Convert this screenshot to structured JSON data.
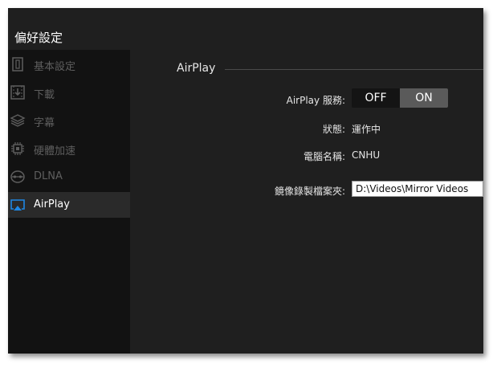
{
  "window": {
    "title": "偏好設定"
  },
  "sidebar": {
    "items": [
      {
        "label": "基本設定",
        "icon": "settings-panel-icon",
        "active": false
      },
      {
        "label": "下載",
        "icon": "download-icon",
        "active": false
      },
      {
        "label": "字幕",
        "icon": "subtitle-layers-icon",
        "active": false
      },
      {
        "label": "硬體加速",
        "icon": "chip-icon",
        "active": false
      },
      {
        "label": "DLNA",
        "icon": "dlna-icon",
        "active": false
      },
      {
        "label": "AirPlay",
        "icon": "airplay-icon",
        "active": true
      }
    ]
  },
  "airplay": {
    "section_title": "AirPlay",
    "service_label": "AirPlay 服務:",
    "toggle_off": "OFF",
    "toggle_on": "ON",
    "toggle_selected": "ON",
    "status_label": "狀態:",
    "status_value": "運作中",
    "computer_name_label": "電腦名稱:",
    "computer_name_value": "CNHU",
    "mirror_folder_label": "鏡像錄製檔案夾:",
    "mirror_folder_value": "D:\\Videos\\Mirror Videos"
  },
  "colors": {
    "background": "#1f1f1f",
    "sidebar": "#121212",
    "active_item": "#2a2a2a",
    "airplay_accent": "#1e88e5",
    "toggle_on": "#5a5a5a",
    "toggle_off": "#141414"
  }
}
